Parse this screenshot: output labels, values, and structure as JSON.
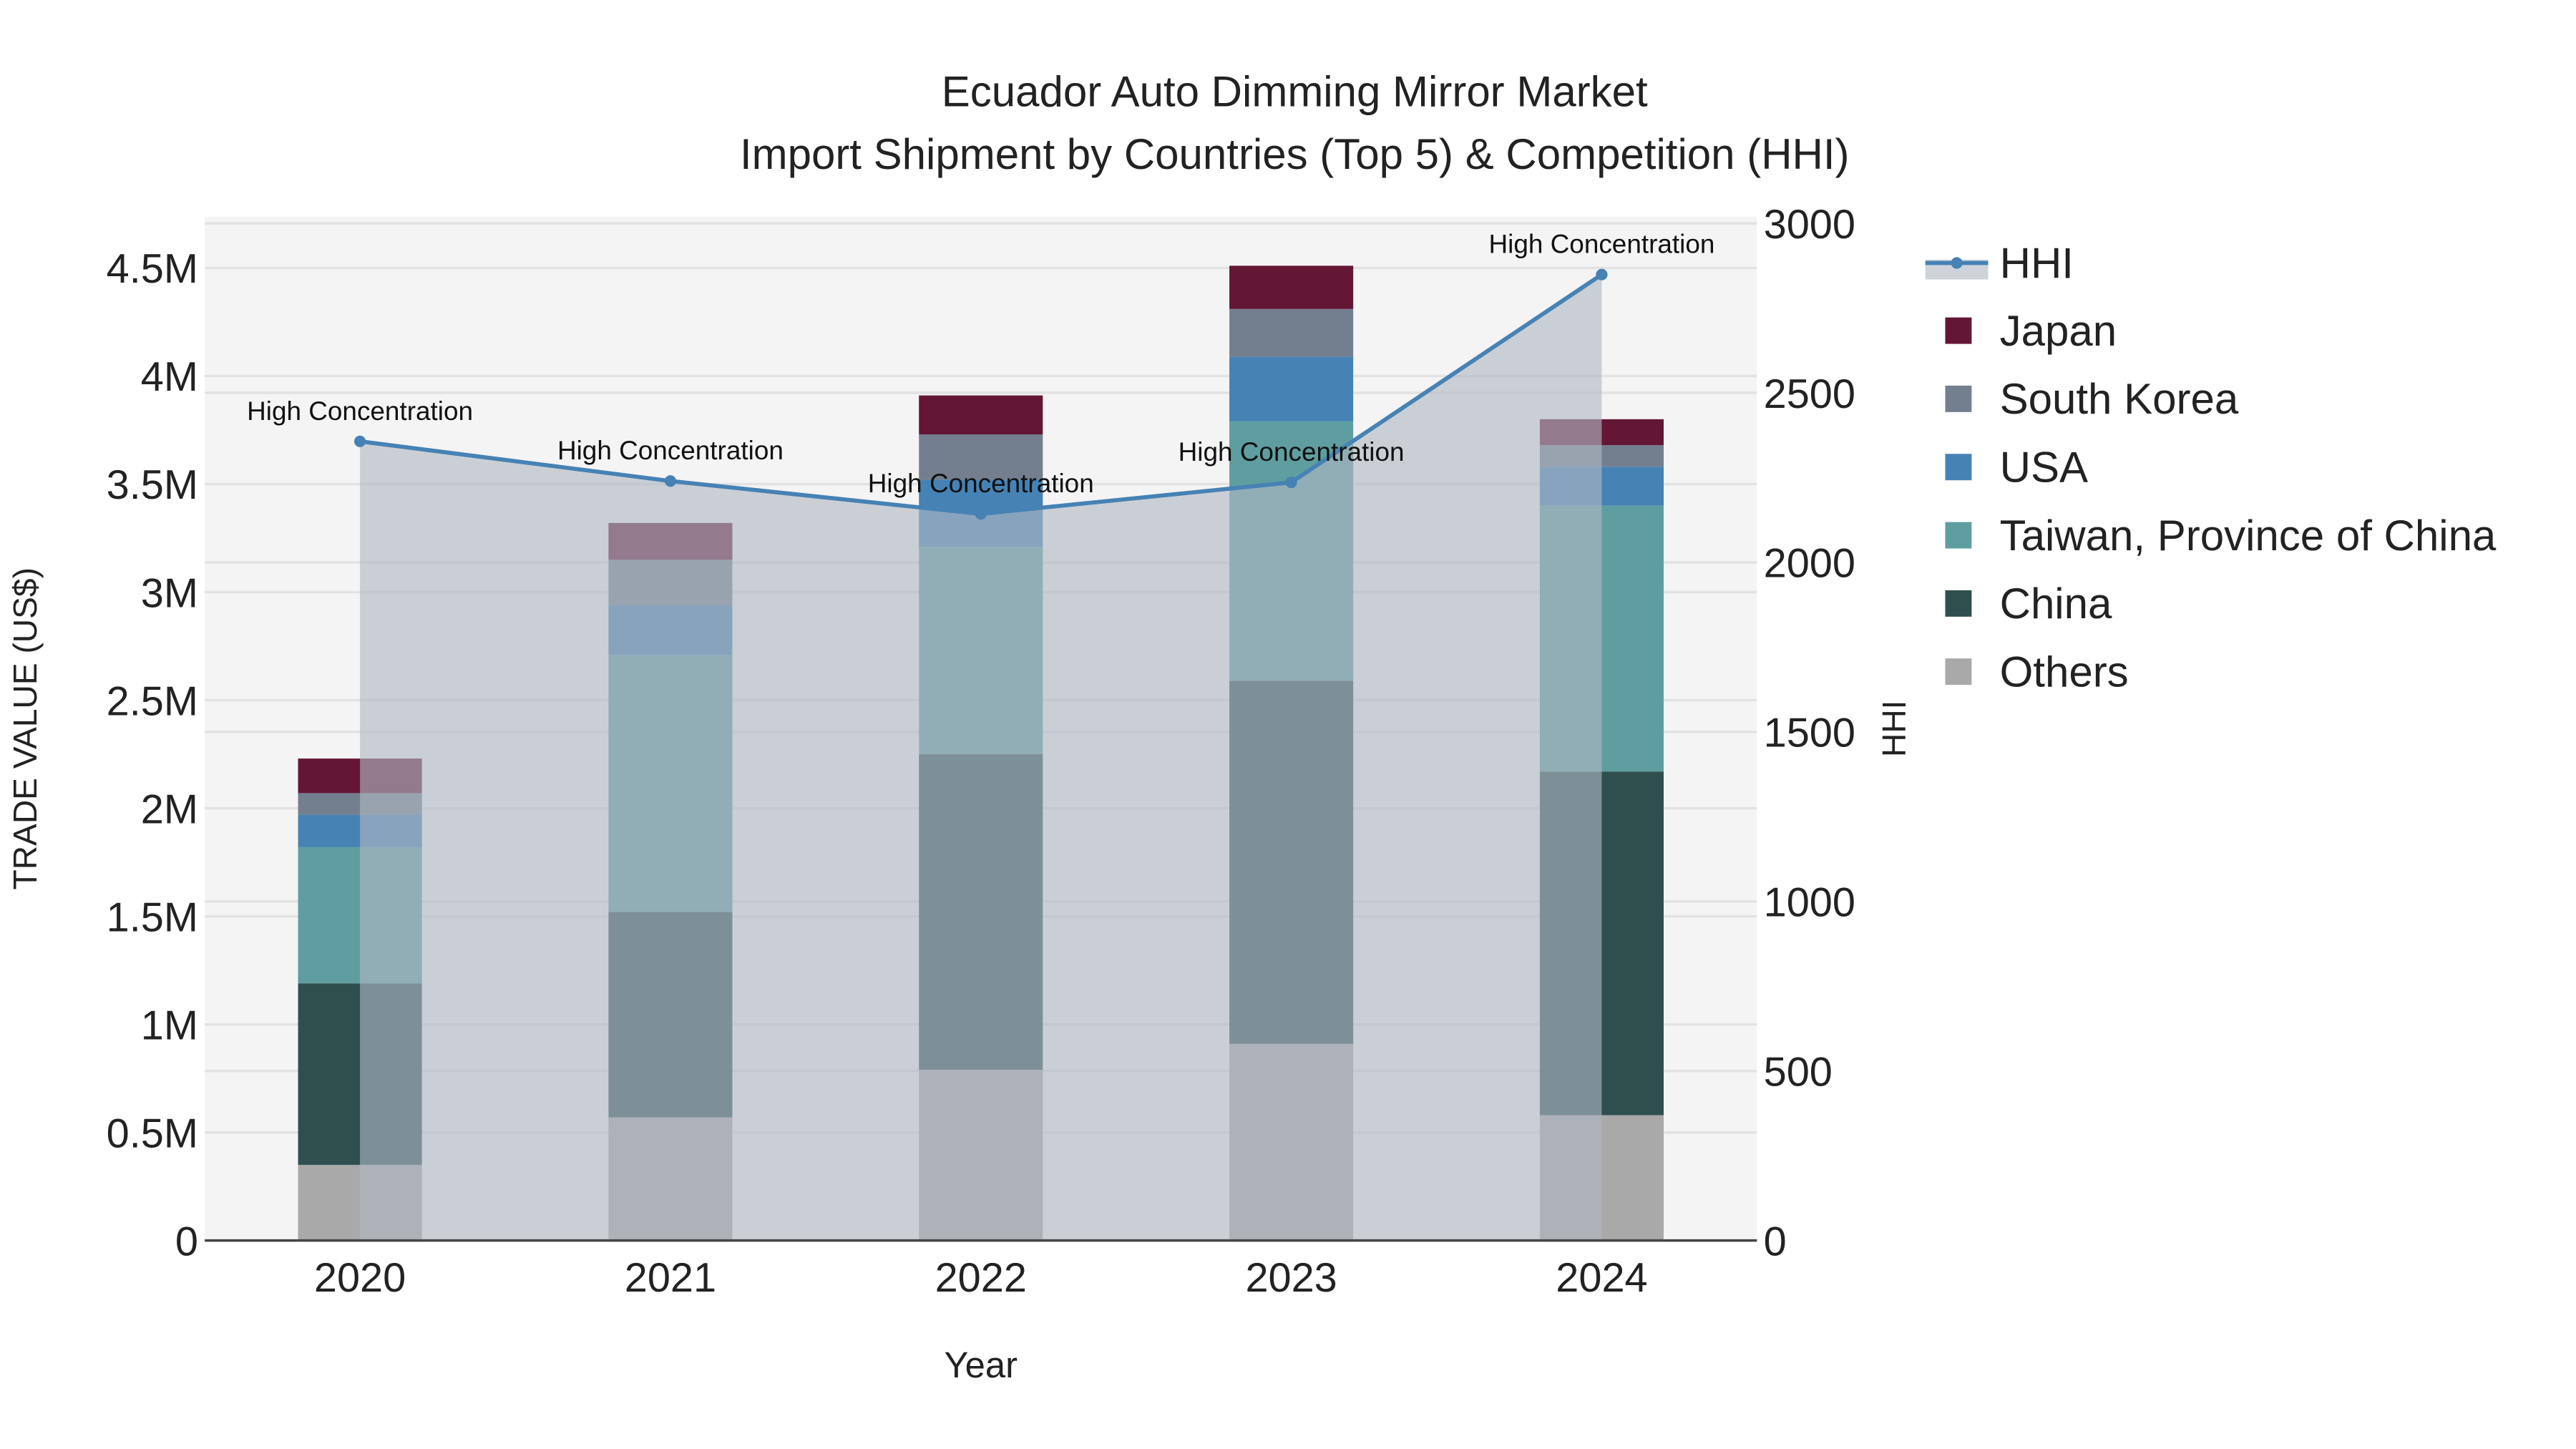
{
  "chart_data": {
    "type": "bar",
    "barmode": "stack",
    "title": "Ecuador Auto Dimming Mirror Market",
    "subtitle": "Import Shipment by Countries (Top 5) & Competition (HHI)",
    "xlabel": "Year",
    "ylabel": "TRADE VALUE (US$)",
    "y2label": "HHI",
    "categories": [
      "2020",
      "2021",
      "2022",
      "2023",
      "2024"
    ],
    "ylim": [
      0,
      4750000
    ],
    "y2lim": [
      0,
      3000
    ],
    "yticks": [
      {
        "value": 0,
        "label": "0"
      },
      {
        "value": 500000,
        "label": "0.5M"
      },
      {
        "value": 1000000,
        "label": "1M"
      },
      {
        "value": 1500000,
        "label": "1.5M"
      },
      {
        "value": 2000000,
        "label": "2M"
      },
      {
        "value": 2500000,
        "label": "2.5M"
      },
      {
        "value": 3000000,
        "label": "3M"
      },
      {
        "value": 3500000,
        "label": "3.5M"
      },
      {
        "value": 4000000,
        "label": "4M"
      },
      {
        "value": 4500000,
        "label": "4.5M"
      }
    ],
    "y2ticks": [
      {
        "value": 0,
        "label": "0"
      },
      {
        "value": 500,
        "label": "500"
      },
      {
        "value": 1000,
        "label": "1000"
      },
      {
        "value": 1500,
        "label": "1500"
      },
      {
        "value": 2000,
        "label": "2000"
      },
      {
        "value": 2500,
        "label": "2500"
      },
      {
        "value": 3000,
        "label": "3000"
      }
    ],
    "series": [
      {
        "name": "Others",
        "color": "#a9a9a9",
        "values": [
          350000,
          570000,
          790000,
          910000,
          580000
        ]
      },
      {
        "name": "China",
        "color": "#2f4f4f",
        "values": [
          840000,
          950000,
          1460000,
          1680000,
          1590000
        ]
      },
      {
        "name": "Taiwan, Province of China",
        "color": "#5f9ea0",
        "values": [
          630000,
          1190000,
          960000,
          1200000,
          1230000
        ]
      },
      {
        "name": "USA",
        "color": "#4682b4",
        "values": [
          150000,
          230000,
          310000,
          300000,
          180000
        ]
      },
      {
        "name": "South Korea",
        "color": "#737f8f",
        "values": [
          100000,
          210000,
          210000,
          220000,
          100000
        ]
      },
      {
        "name": "Japan",
        "color": "#641635",
        "values": [
          160000,
          170000,
          180000,
          200000,
          120000
        ]
      }
    ],
    "line": {
      "name": "HHI",
      "color": "#4682b4",
      "axis": "y2",
      "values": [
        2357,
        2240,
        2143,
        2236,
        2849
      ],
      "annotations": [
        "High Concentration",
        "High Concentration",
        "High Concentration",
        "High Concentration",
        "High Concentration"
      ]
    },
    "legend_order": [
      "HHI",
      "Japan",
      "South Korea",
      "USA",
      "Taiwan, Province of China",
      "China",
      "Others"
    ],
    "legend_position": "right",
    "grid": true
  }
}
